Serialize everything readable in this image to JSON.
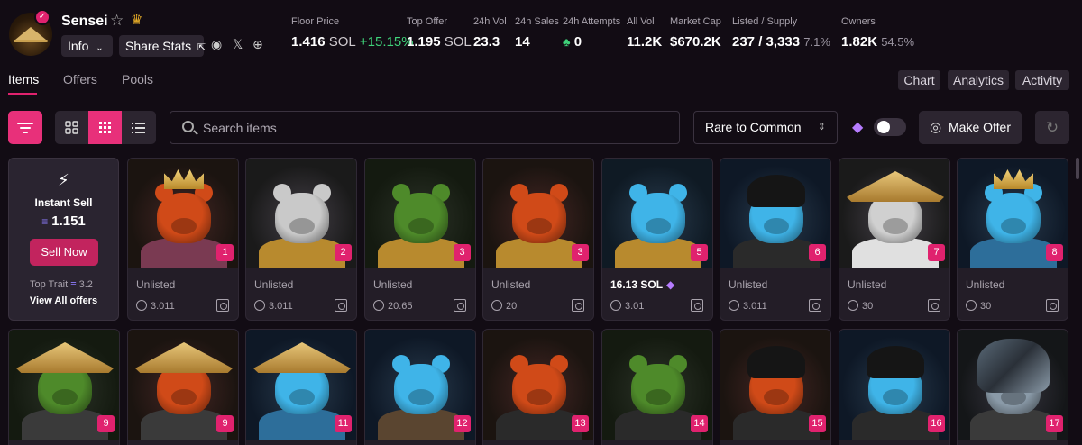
{
  "collection": {
    "name": "Sensei",
    "info_label": "Info",
    "share_label": "Share Stats"
  },
  "stats": [
    {
      "label": "Floor Price",
      "value": "1.416",
      "unit": "SOL",
      "change": "+15.15%"
    },
    {
      "label": "Top Offer",
      "value": "1.195",
      "unit": "SOL"
    },
    {
      "label": "24h Vol",
      "value": "23.3"
    },
    {
      "label": "24h Sales",
      "value": "14"
    },
    {
      "label": "24h Attempts",
      "value": "0"
    },
    {
      "label": "All Vol",
      "value": "11.2K"
    },
    {
      "label": "Market Cap",
      "value": "$670.2K"
    },
    {
      "label": "Listed / Supply",
      "value": "237 / 3,333",
      "pct": "7.1%"
    },
    {
      "label": "Owners",
      "value": "1.82K",
      "pct": "54.5%"
    }
  ],
  "tabs": [
    "Items",
    "Offers",
    "Pools"
  ],
  "right_tabs": [
    "Chart",
    "Analytics",
    "Activity"
  ],
  "search": {
    "placeholder": "Search items"
  },
  "sort": {
    "selected": "Rare to Common"
  },
  "make_offer_label": "Make Offer",
  "instant_sell": {
    "title": "Instant Sell",
    "price": "1.151",
    "button": "Sell Now",
    "top_trait_label": "Top Trait",
    "top_trait_value": "3.2",
    "view_all": "View All offers"
  },
  "cards": [
    {
      "rank": "1",
      "status": "Unlisted",
      "offer": "3.011",
      "fur": "#d04a18",
      "bg": "#1b1410",
      "hat": "crown",
      "body": "#7a3a52",
      "row": 0,
      "col": 0
    },
    {
      "rank": "2",
      "status": "Unlisted",
      "offer": "3.011",
      "fur": "#c9c9c9",
      "bg": "#1a1a1a",
      "hat": "none",
      "body": "#b88a2e",
      "row": 0,
      "col": 1
    },
    {
      "rank": "3",
      "status": "Unlisted",
      "offer": "20.65",
      "fur": "#4e8a2a",
      "bg": "#141a10",
      "hat": "none",
      "body": "#b88a2e",
      "row": 0,
      "col": 2
    },
    {
      "rank": "3",
      "status": "Unlisted",
      "offer": "20",
      "fur": "#d04a18",
      "bg": "#1b1410",
      "hat": "none",
      "body": "#b88a2e",
      "row": 0,
      "col": 3
    },
    {
      "rank": "5",
      "status": "16.13 SOL",
      "offer": "3.01",
      "fur": "#3fb4e8",
      "bg": "#0f1a24",
      "hat": "none",
      "body": "#b88a2e",
      "row": 0,
      "col": 4,
      "listed": true
    },
    {
      "rank": "6",
      "status": "Unlisted",
      "offer": "3.011",
      "fur": "#3fb4e8",
      "bg": "#0e1826",
      "hat": "beanie",
      "body": "#2a2a2a",
      "row": 0,
      "col": 5
    },
    {
      "rank": "7",
      "status": "Unlisted",
      "offer": "30",
      "fur": "#d0d0d0",
      "bg": "#1a1a1a",
      "hat": "straw",
      "body": "#e0e0e0",
      "row": 0,
      "col": 6
    },
    {
      "rank": "8",
      "status": "Unlisted",
      "offer": "30",
      "fur": "#3fb4e8",
      "bg": "#0e1826",
      "hat": "crown",
      "body": "#2d6e9a",
      "row": 0,
      "col": 7
    },
    {
      "rank": "9",
      "status": "",
      "offer": "",
      "fur": "#4e8a2a",
      "bg": "#141a10",
      "hat": "straw",
      "body": "#3a3a3a",
      "row": 1,
      "col": 0
    },
    {
      "rank": "9",
      "status": "",
      "offer": "",
      "fur": "#d04a18",
      "bg": "#1b1410",
      "hat": "straw",
      "body": "#3a3a3a",
      "row": 1,
      "col": 1
    },
    {
      "rank": "11",
      "status": "",
      "offer": "",
      "fur": "#3fb4e8",
      "bg": "#0e1826",
      "hat": "straw",
      "body": "#2d6e9a",
      "row": 1,
      "col": 2
    },
    {
      "rank": "12",
      "status": "",
      "offer": "",
      "fur": "#3fb4e8",
      "bg": "#0e1826",
      "hat": "none",
      "body": "#5a4530",
      "row": 1,
      "col": 3
    },
    {
      "rank": "13",
      "status": "",
      "offer": "",
      "fur": "#d04a18",
      "bg": "#1b1410",
      "hat": "none",
      "body": "#2a2a2a",
      "row": 1,
      "col": 4
    },
    {
      "rank": "14",
      "status": "",
      "offer": "",
      "fur": "#4e8a2a",
      "bg": "#141a10",
      "hat": "none",
      "body": "#2a2a2a",
      "row": 1,
      "col": 5
    },
    {
      "rank": "15",
      "status": "",
      "offer": "",
      "fur": "#d04a18",
      "bg": "#1b1410",
      "hat": "beanie",
      "body": "#2a2a2a",
      "row": 1,
      "col": 6
    },
    {
      "rank": "16",
      "status": "",
      "offer": "",
      "fur": "#3fb4e8",
      "bg": "#0e1826",
      "hat": "beanie",
      "body": "#2a2a2a",
      "row": 1,
      "col": 7
    },
    {
      "rank": "17",
      "status": "",
      "offer": "",
      "fur": "#8a9aa8",
      "bg": "#141618",
      "hat": "hood",
      "body": "#3a3a3a",
      "row": 1,
      "col": 8
    }
  ],
  "colors": {
    "accent": "#e0226e",
    "bg": "#120c14",
    "panel": "#2c2530",
    "positive": "#3fd37a"
  },
  "icons": [
    "verified-icon",
    "star-icon",
    "crown-icon",
    "chevron-down-icon",
    "share-icon",
    "discord-icon",
    "x-icon",
    "globe-icon",
    "filter-icon",
    "grid-large-icon",
    "grid-small-icon",
    "list-icon",
    "search-icon",
    "sort-chevron-icon",
    "gem-icon",
    "coins-icon",
    "refresh-icon",
    "bolt-icon",
    "sol-icon",
    "offer-icon",
    "expand-icon"
  ]
}
